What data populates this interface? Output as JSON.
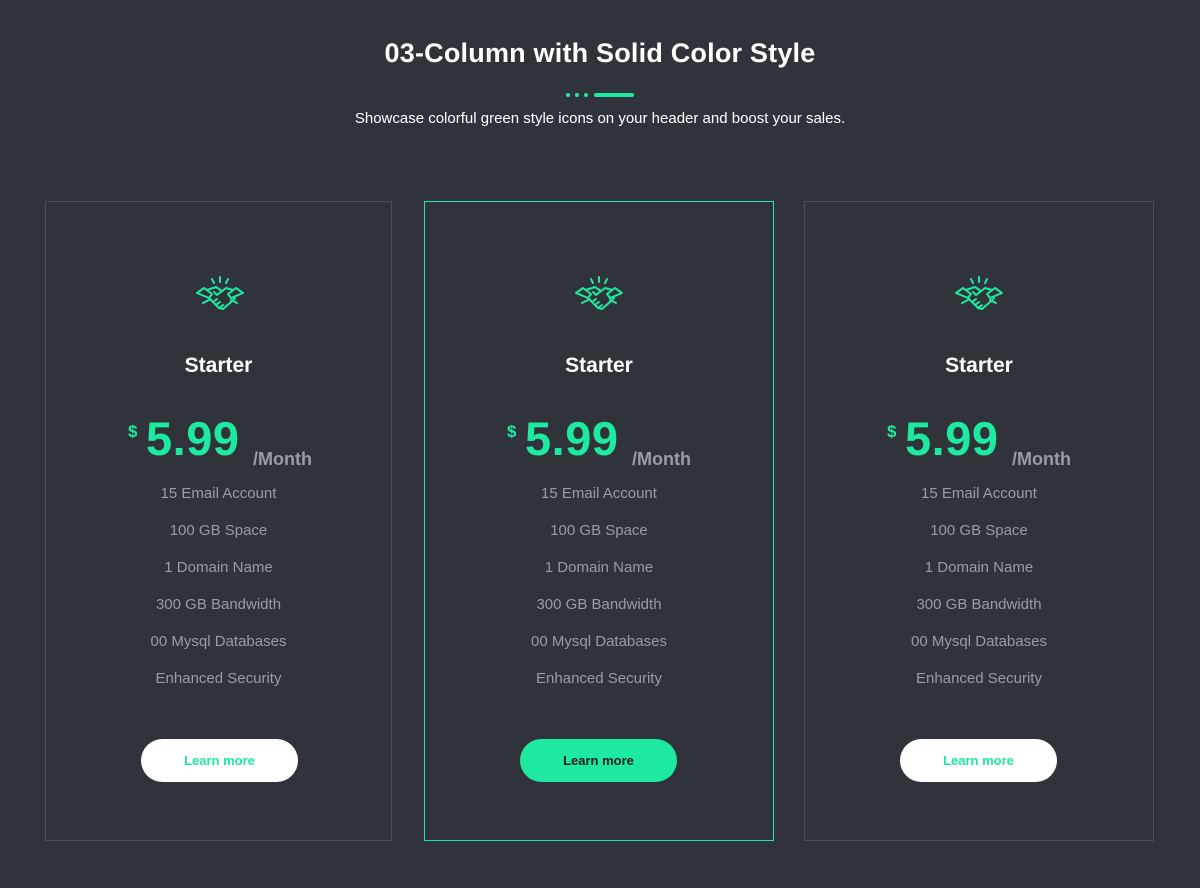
{
  "colors": {
    "background": "#30333a",
    "accent": "#1de9a0",
    "card_border": "#4a4e56",
    "muted_text": "#9a9ca0"
  },
  "header": {
    "title": "03-Column with Solid Color Style",
    "subtitle": "Showcase colorful green style icons on your header and boost your sales."
  },
  "plans": [
    {
      "icon": "handshake-icon",
      "name": "Starter",
      "currency": "$",
      "price": "5.99",
      "period": "/Month",
      "features": [
        "15 Email Account",
        "100 GB Space",
        "1 Domain Name",
        "300 GB Bandwidth",
        "00 Mysql Databases",
        "Enhanced Security"
      ],
      "button_label": "Learn more",
      "featured": false
    },
    {
      "icon": "handshake-icon",
      "name": "Starter",
      "currency": "$",
      "price": "5.99",
      "period": "/Month",
      "features": [
        "15 Email Account",
        "100 GB Space",
        "1 Domain Name",
        "300 GB Bandwidth",
        "00 Mysql Databases",
        "Enhanced Security"
      ],
      "button_label": "Learn more",
      "featured": true
    },
    {
      "icon": "handshake-icon",
      "name": "Starter",
      "currency": "$",
      "price": "5.99",
      "period": "/Month",
      "features": [
        "15 Email Account",
        "100 GB Space",
        "1 Domain Name",
        "300 GB Bandwidth",
        "00 Mysql Databases",
        "Enhanced Security"
      ],
      "button_label": "Learn more",
      "featured": false
    }
  ]
}
